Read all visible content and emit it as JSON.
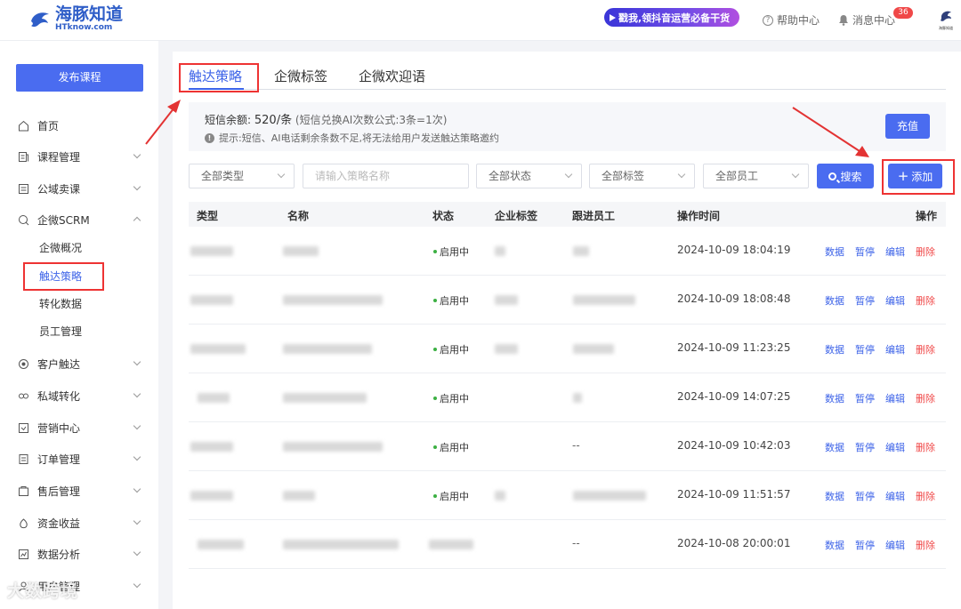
{
  "header": {
    "logo_cn": "海豚知道",
    "logo_en": "HTknow.com",
    "promo_text": "戳我,领抖音运营必备干货",
    "help_label": "帮助中心",
    "message_label": "消息中心",
    "message_badge": "36",
    "avatar_caption": "海豚知道"
  },
  "sidebar": {
    "publish_label": "发布课程",
    "items": [
      {
        "label": "首页",
        "icon": "home-icon",
        "expandable": false
      },
      {
        "label": "课程管理",
        "icon": "course-icon",
        "expandable": true
      },
      {
        "label": "公域卖课",
        "icon": "public-sale-icon",
        "expandable": true
      },
      {
        "label": "企微SCRM",
        "icon": "scrm-icon",
        "expandable": true,
        "expanded": true
      },
      {
        "label": "客户触达",
        "icon": "reach-icon",
        "expandable": true
      },
      {
        "label": "私域转化",
        "icon": "private-icon",
        "expandable": true
      },
      {
        "label": "营销中心",
        "icon": "marketing-icon",
        "expandable": true
      },
      {
        "label": "订单管理",
        "icon": "order-icon",
        "expandable": true
      },
      {
        "label": "售后管理",
        "icon": "aftersale-icon",
        "expandable": true
      },
      {
        "label": "资金收益",
        "icon": "money-icon",
        "expandable": true
      },
      {
        "label": "数据分析",
        "icon": "analytics-icon",
        "expandable": true
      },
      {
        "label": "用户管理",
        "icon": "user-icon",
        "expandable": true
      }
    ],
    "sub_items": [
      "企微概况",
      "触达策略",
      "转化数据",
      "员工管理"
    ],
    "active_sub": "触达策略"
  },
  "main": {
    "tabs": [
      "触达策略",
      "企微标签",
      "企微欢迎语"
    ],
    "active_tab": "触达策略",
    "notice": {
      "balance_label": "短信余额:",
      "balance_value": "520/条",
      "balance_note": "(短信兑换AI次数公式:3条=1次)",
      "tip": "提示:短信、AI电话剩余条数不足,将无法给用户发送触达策略邀约"
    },
    "recharge_label": "充值",
    "filters": {
      "type": "全部类型",
      "name_placeholder": "请输入策略名称",
      "status": "全部状态",
      "tag": "全部标签",
      "staff": "全部员工"
    },
    "search_label": "搜索",
    "add_label": "添加",
    "columns": [
      "类型",
      "名称",
      "状态",
      "企业标签",
      "跟进员工",
      "操作时间",
      "操作"
    ],
    "rows": [
      {
        "status": "启用中",
        "staff": "",
        "time": "2024-10-09 18:04:19"
      },
      {
        "status": "启用中",
        "staff": "",
        "time": "2024-10-09 18:08:48"
      },
      {
        "status": "启用中",
        "staff": "",
        "time": "2024-10-09 11:23:25"
      },
      {
        "status": "启用中",
        "staff": "",
        "time": "2024-10-09 14:07:25"
      },
      {
        "status": "启用中",
        "staff": "--",
        "time": "2024-10-09 10:42:03"
      },
      {
        "status": "启用中",
        "staff": "",
        "time": "2024-10-09 11:51:57"
      },
      {
        "status": "",
        "staff": "--",
        "time": "2024-10-08 20:00:01"
      }
    ],
    "actions": [
      "数据",
      "暂停",
      "编辑",
      "删除"
    ]
  },
  "watermark": "大数跨境",
  "colors": {
    "primary": "#4a6cf0",
    "active_text": "#3d63e8",
    "danger": "#f04848",
    "annotation": "#e33333",
    "status_green": "#3cb043"
  }
}
